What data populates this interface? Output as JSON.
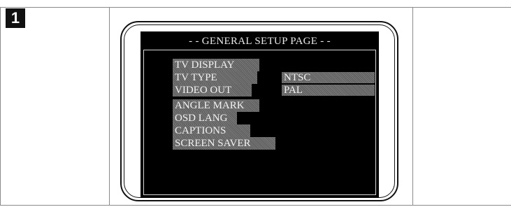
{
  "step": {
    "number": "1"
  },
  "screen": {
    "title": "- - GENERAL SETUP PAGE - -",
    "menu": [
      "TV DISPLAY",
      "TV TYPE",
      "VIDEO OUT",
      "ANGLE MARK",
      "OSD LANG",
      "CAPTIONS",
      "SCREEN SAVER"
    ],
    "options": [
      "NTSC",
      "PAL"
    ]
  },
  "colors": {
    "screen_bg": "#000000",
    "highlight": "#6b6b6b",
    "text": "#f2f2f2"
  }
}
